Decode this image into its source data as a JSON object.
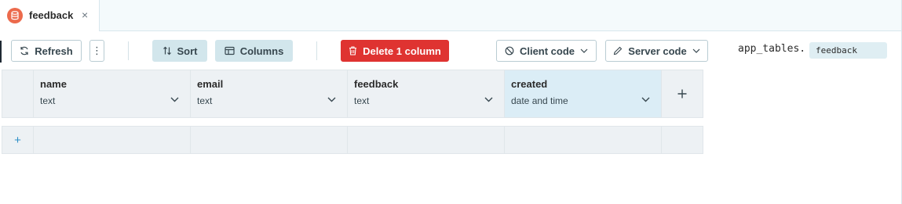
{
  "tab": {
    "label": "feedback",
    "close": "×",
    "icon": "database-icon",
    "icon_color": "#ec6a4c"
  },
  "toolbar": {
    "refresh_label": "Refresh",
    "more_label": "⋮",
    "sort_label": "Sort",
    "columns_label": "Columns",
    "delete_label": "Delete 1 column",
    "client_code_label": "Client code",
    "server_code_label": "Server code",
    "code_prefix": "app_tables.",
    "code_table": "feedback",
    "danger_color": "#df3331"
  },
  "table": {
    "columns": [
      {
        "name": "name",
        "type": "text"
      },
      {
        "name": "email",
        "type": "text"
      },
      {
        "name": "feedback",
        "type": "text"
      },
      {
        "name": "created",
        "type": "date and time",
        "selected": true
      }
    ],
    "add_column": "+",
    "add_row": "+"
  }
}
